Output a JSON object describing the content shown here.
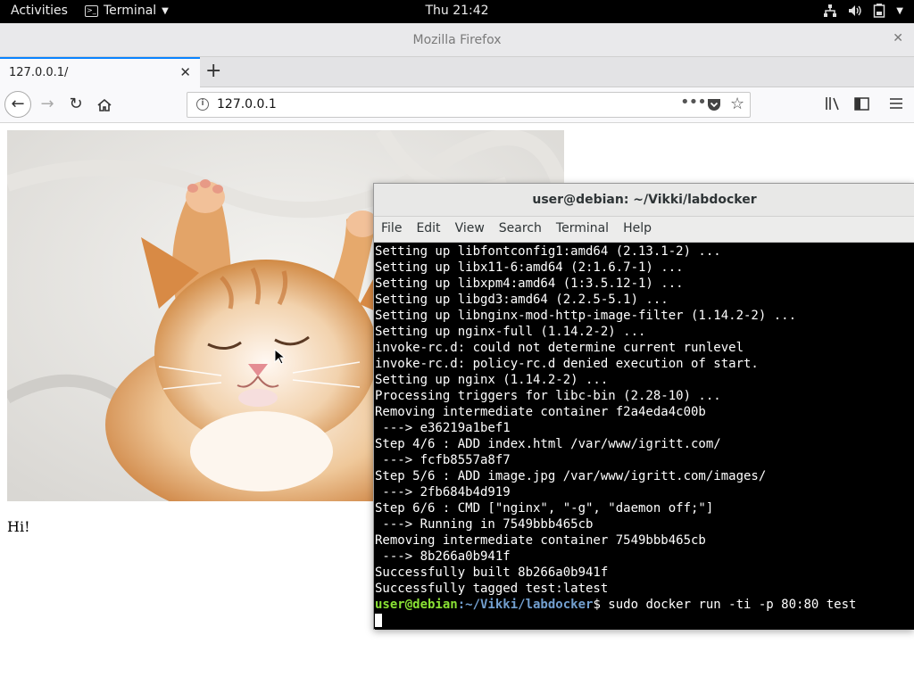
{
  "topbar": {
    "activities": "Activities",
    "app_menu": "Terminal",
    "clock": "Thu 21:42",
    "icons": [
      "network-icon",
      "volume-icon",
      "battery-icon",
      "chevron-down-icon"
    ]
  },
  "firefox": {
    "window_title": "Mozilla Firefox",
    "tab_label": "127.0.0.1/",
    "url": "127.0.0.1",
    "accent": "#0a84ff"
  },
  "page": {
    "text": "Hi!",
    "image": "kitten-photo"
  },
  "terminal": {
    "title": "user@debian: ~/Vikki/labdocker",
    "menu": [
      "File",
      "Edit",
      "View",
      "Search",
      "Terminal",
      "Help"
    ],
    "lines": [
      "Setting up libfontconfig1:amd64 (2.13.1-2) ...",
      "Setting up libx11-6:amd64 (2:1.6.7-1) ...",
      "Setting up libxpm4:amd64 (1:3.5.12-1) ...",
      "Setting up libgd3:amd64 (2.2.5-5.1) ...",
      "Setting up libnginx-mod-http-image-filter (1.14.2-2) ...",
      "Setting up nginx-full (1.14.2-2) ...",
      "invoke-rc.d: could not determine current runlevel",
      "invoke-rc.d: policy-rc.d denied execution of start.",
      "Setting up nginx (1.14.2-2) ...",
      "Processing triggers for libc-bin (2.28-10) ...",
      "Removing intermediate container f2a4eda4c00b",
      " ---> e36219a1bef1",
      "Step 4/6 : ADD index.html /var/www/igritt.com/",
      " ---> fcfb8557a8f7",
      "Step 5/6 : ADD image.jpg /var/www/igritt.com/images/",
      " ---> 2fb684b4d919",
      "Step 6/6 : CMD [\"nginx\", \"-g\", \"daemon off;\"]",
      " ---> Running in 7549bbb465cb",
      "Removing intermediate container 7549bbb465cb",
      " ---> 8b266a0b941f",
      "Successfully built 8b266a0b941f",
      "Successfully tagged test:latest"
    ],
    "prompt_user": "user@debian",
    "prompt_path": ":~/Vikki/labdocker",
    "prompt_symbol": "$",
    "command": " sudo docker run -ti -p 80:80 test",
    "colors": {
      "user": "#8ae234",
      "path": "#729fcf",
      "bg": "#000000"
    }
  }
}
